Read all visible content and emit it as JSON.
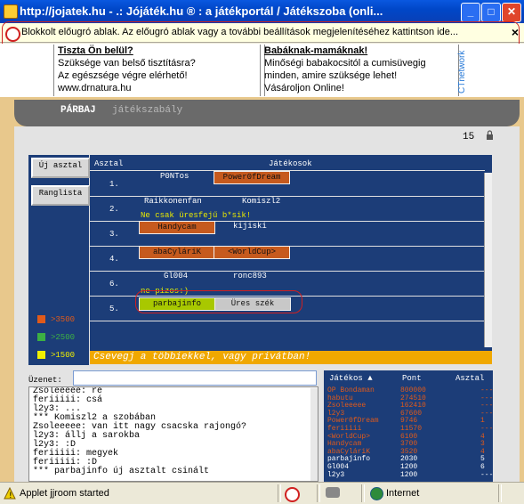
{
  "window": {
    "title": "http://jojatek.hu - .: Jójáték.hu ® : a játékportál / Játékszoba (onli..."
  },
  "popup_bar": {
    "text": "Blokkolt előugró ablak. Az előugró ablak vagy a további beállítások megjelenítéséhez kattintson ide...",
    "close_glyph": "×"
  },
  "ads": [
    {
      "title": "Tiszta Ön belül?",
      "lines": [
        "Szüksége van belső tisztításra?",
        "Az egészsége végre elérhető!",
        "www.drnatura.hu"
      ]
    },
    {
      "title": "Babáknak-mamáknak!",
      "lines": [
        "Minőségi babakocsitól a cumisüvegig",
        "minden, amire szüksége lehet!",
        "Vásároljon Online!"
      ]
    }
  ],
  "ad_network_label": "CTnetwork",
  "nav": {
    "tab_active": "PÁRBAJ",
    "tab_inactive": "játékszabály"
  },
  "counter": "15",
  "left_panel": {
    "new_table_button": "Új asztal",
    "ranking_button": "Ranglista",
    "legend": [
      {
        "label": ">3500",
        "color": "#e05a1a"
      },
      {
        "label": ">2500",
        "color": "#3cb043"
      },
      {
        "label": ">1500",
        "color": "#f0f000"
      }
    ]
  },
  "table": {
    "col_table": "Asztal",
    "col_players": "Játékosok",
    "rows": [
      {
        "num": "1.",
        "p1": "P0NTos",
        "p1_boxed": false,
        "p2": "Power0fDream",
        "p2_boxed": true,
        "msg": ""
      },
      {
        "num": "2.",
        "p1": "Raikkonenfan",
        "p1_boxed": false,
        "p2": "Komiszl2",
        "p2_boxed": false,
        "msg": "Ne csak üresfejű b*sik!"
      },
      {
        "num": "3.",
        "p1": "Handycam",
        "p1_boxed": true,
        "p2": "kijiski",
        "p2_boxed": false,
        "msg": ""
      },
      {
        "num": "4.",
        "p1": "abaCyláriK",
        "p1_boxed": true,
        "p2": "<WorldCup>",
        "p2_boxed": true,
        "msg": ""
      },
      {
        "num": "6.",
        "p1": "Gl004",
        "p1_boxed": false,
        "p2": "ronc893",
        "p2_boxed": false,
        "msg": "ne pizos:)"
      },
      {
        "num": "5.",
        "p1": "parbajinfo",
        "p1_boxed": true,
        "p2": "Üres szék",
        "p2_boxed": true,
        "msg": ""
      }
    ]
  },
  "chat_banner": "Csevegj a többiekkel, vagy privátban!",
  "message": {
    "label": "Üzenet:",
    "value": ""
  },
  "chat_log": [
    "Zsoleeeee: re",
    "feriiiii: csá",
    "l2y3: ...",
    "*** Komiszl2 a szobában",
    "Zsoleeeee: van itt nagy csacska rajongó?",
    "l2y3: állj a sarokba",
    "l2y3: :D",
    "feriiiii: megyek",
    "feriiiii: :D",
    "*** parbajinfo új asztalt csinált"
  ],
  "players_list": {
    "col_player": "Játékos ▲",
    "col_points": "Pont",
    "col_table": "Asztal",
    "rows": [
      {
        "name": "OP Bondaman",
        "points": "800000",
        "table": "---",
        "color": "#e05a1a"
      },
      {
        "name": "habutu",
        "points": "274510",
        "table": "---",
        "color": "#e05a1a"
      },
      {
        "name": "Zsoleeeee",
        "points": "162410",
        "table": "---",
        "color": "#e05a1a"
      },
      {
        "name": "l2y3",
        "points": "67600",
        "table": "---",
        "color": "#e05a1a"
      },
      {
        "name": "Power0fDream",
        "points": "9746",
        "table": "1",
        "color": "#e05a1a"
      },
      {
        "name": "feriiiii",
        "points": "11570",
        "table": "---",
        "color": "#e05a1a"
      },
      {
        "name": "<WorldCup>",
        "points": "6100",
        "table": "4",
        "color": "#e05a1a"
      },
      {
        "name": "Handycam",
        "points": "3700",
        "table": "3",
        "color": "#e05a1a"
      },
      {
        "name": "abaCyláriK",
        "points": "3520",
        "table": "4",
        "color": "#e05a1a"
      },
      {
        "name": "parbajinfo",
        "points": "2030",
        "table": "5",
        "color": "#ffffff"
      },
      {
        "name": "Gl004",
        "points": "1200",
        "table": "6",
        "color": "#ffffff"
      },
      {
        "name": "l2y3",
        "points": "1200",
        "table": "---",
        "color": "#ffffff"
      }
    ]
  },
  "status_bar": {
    "text": "Applet jjroom started",
    "zone": "Internet"
  }
}
